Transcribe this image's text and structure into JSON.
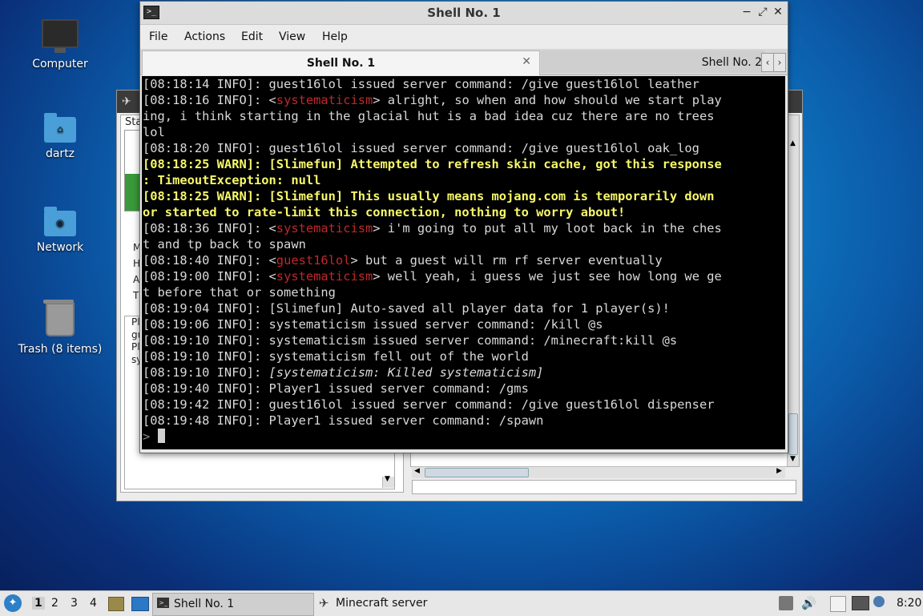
{
  "desktop": {
    "icons": [
      {
        "label": "Computer",
        "icon": "computer-icon"
      },
      {
        "label": "dartz",
        "icon": "home-folder-icon"
      },
      {
        "label": "Network",
        "icon": "network-folder-icon"
      },
      {
        "label": "Trash (8 items)",
        "icon": "trash-icon"
      }
    ]
  },
  "background_window": {
    "title": "Minecraft server",
    "partial_left_text": [
      "Sta",
      "M",
      "H",
      "A",
      "T",
      "Pl",
      "gu",
      "Pl",
      "sy"
    ]
  },
  "shell": {
    "title": "Shell No. 1",
    "menu": [
      "File",
      "Actions",
      "Edit",
      "View",
      "Help"
    ],
    "tabs": [
      {
        "label": "Shell No. 1",
        "active": true
      },
      {
        "label": "Shell No. 2",
        "active": false
      }
    ],
    "prompt": ">",
    "lines": [
      {
        "segments": [
          {
            "t": "[08:18:14 INFO]: guest16lol issued server command: /give guest16lol leather",
            "c": "n"
          }
        ]
      },
      {
        "segments": [
          {
            "t": "[08:18:16 INFO]: <",
            "c": "n"
          },
          {
            "t": "systematicism",
            "c": "red"
          },
          {
            "t": "> alright, so when and how should we start play",
            "c": "n"
          }
        ]
      },
      {
        "segments": [
          {
            "t": "ing, i think starting in the glacial hut is a bad idea cuz there are no trees",
            "c": "n"
          }
        ]
      },
      {
        "segments": [
          {
            "t": "lol",
            "c": "n"
          }
        ]
      },
      {
        "segments": [
          {
            "t": "[08:18:20 INFO]: guest16lol issued server command: /give guest16lol oak_log",
            "c": "n"
          }
        ]
      },
      {
        "segments": [
          {
            "t": "[08:18:25 WARN]: [Slimefun] Attempted to refresh skin cache, got this response",
            "c": "warn"
          }
        ]
      },
      {
        "segments": [
          {
            "t": ": TimeoutException: null",
            "c": "warn"
          }
        ]
      },
      {
        "segments": [
          {
            "t": "[08:18:25 WARN]: [Slimefun] This usually means mojang.com is temporarily down",
            "c": "warn"
          }
        ]
      },
      {
        "segments": [
          {
            "t": "or started to rate-limit this connection, nothing to worry about!",
            "c": "warn"
          }
        ]
      },
      {
        "segments": [
          {
            "t": "[08:18:36 INFO]: <",
            "c": "n"
          },
          {
            "t": "systematicism",
            "c": "red"
          },
          {
            "t": "> i'm going to put all my loot back in the ches",
            "c": "n"
          }
        ]
      },
      {
        "segments": [
          {
            "t": "t and tp back to spawn",
            "c": "n"
          }
        ]
      },
      {
        "segments": [
          {
            "t": "[08:18:40 INFO]: <",
            "c": "n"
          },
          {
            "t": "guest16lol",
            "c": "red"
          },
          {
            "t": "> but a guest will rm rf server eventually",
            "c": "n"
          }
        ]
      },
      {
        "segments": [
          {
            "t": "[08:19:00 INFO]: <",
            "c": "n"
          },
          {
            "t": "systematicism",
            "c": "red"
          },
          {
            "t": "> well yeah, i guess we just see how long we ge",
            "c": "n"
          }
        ]
      },
      {
        "segments": [
          {
            "t": "t before that or something",
            "c": "n"
          }
        ]
      },
      {
        "segments": [
          {
            "t": "[08:19:04 INFO]: [Slimefun] Auto-saved all player data for 1 player(s)!",
            "c": "n"
          }
        ]
      },
      {
        "segments": [
          {
            "t": "[08:19:06 INFO]: systematicism issued server command: /kill @s",
            "c": "n"
          }
        ]
      },
      {
        "segments": [
          {
            "t": "[08:19:10 INFO]: systematicism issued server command: /minecraft:kill @s",
            "c": "n"
          }
        ]
      },
      {
        "segments": [
          {
            "t": "[08:19:10 INFO]: systematicism fell out of the world",
            "c": "n"
          }
        ]
      },
      {
        "segments": [
          {
            "t": "[08:19:10 INFO]: ",
            "c": "n"
          },
          {
            "t": "[systematicism: Killed systematicism]",
            "c": "ital"
          }
        ]
      },
      {
        "segments": [
          {
            "t": "[08:19:40 INFO]: Player1 issued server command: /gms",
            "c": "n"
          }
        ]
      },
      {
        "segments": [
          {
            "t": "[08:19:42 INFO]: guest16lol issued server command: /give guest16lol dispenser",
            "c": "n"
          }
        ]
      },
      {
        "segments": [
          {
            "t": "[08:19:48 INFO]: Player1 issued server command: /spawn",
            "c": "n"
          }
        ]
      }
    ]
  },
  "taskbar": {
    "workspaces": [
      "1",
      "2",
      "3",
      "4"
    ],
    "tasks": [
      {
        "label": "Shell No. 1",
        "icon": "terminal-icon"
      },
      {
        "label": "Minecraft server",
        "icon": "minecraft-icon"
      }
    ],
    "clock": "8:20"
  },
  "colors": {
    "terminal_bg": "#000000",
    "warn": "#f7f76a",
    "player_name": "#c0282a"
  }
}
